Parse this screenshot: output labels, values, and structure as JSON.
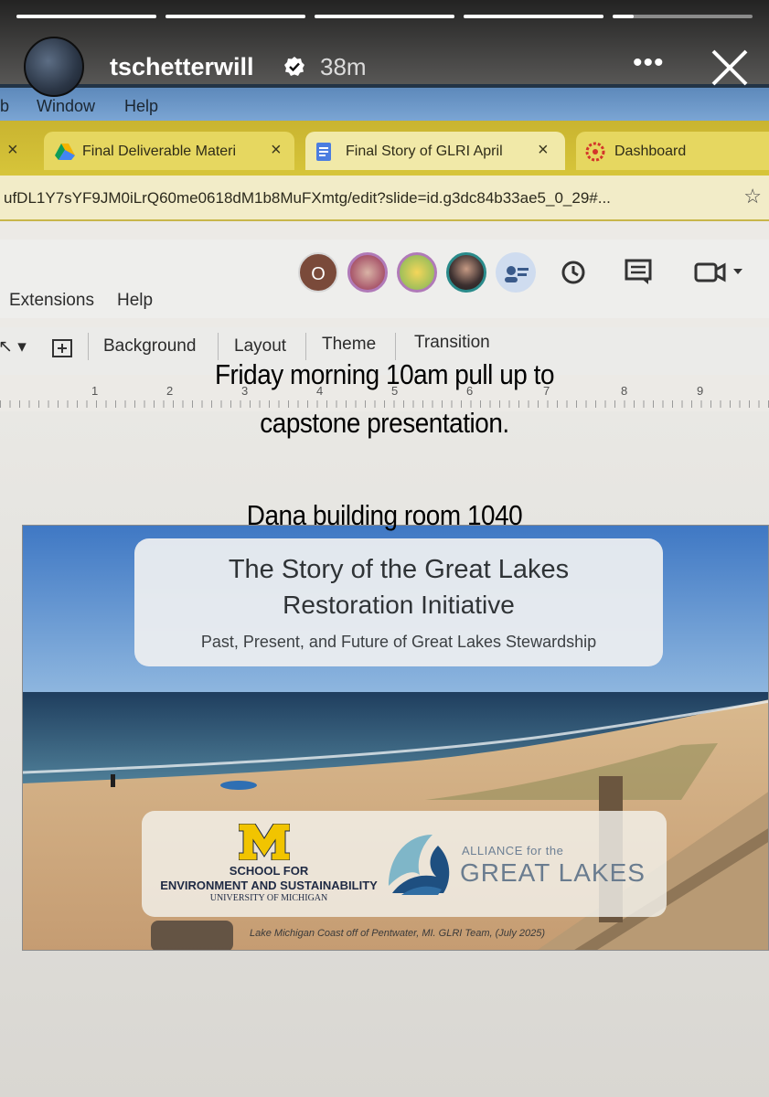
{
  "story": {
    "username": "tschetterwill",
    "time_ago": "38m",
    "progress_segments": [
      1,
      1,
      1,
      1,
      0.15
    ],
    "text_lines": [
      "Friday morning 10am pull up to",
      "capstone presentation.",
      "Dana building room 1040"
    ]
  },
  "browser": {
    "menu": [
      "b",
      "Window",
      "Help"
    ],
    "tabs": [
      {
        "label": "Final Deliverable Materi",
        "icon": "drive-icon"
      },
      {
        "label": "Final Story of GLRI April",
        "icon": "slides-icon"
      },
      {
        "label": "Dashboard",
        "icon": "canvas-icon"
      }
    ],
    "url": "ufDL1Y7sYF9JM0iLrQ60me0618dM1b8MuFXmtg/edit?slide=id.g3dc84b33ae5_0_29#...",
    "doc_menu": [
      "Extensions",
      "Help"
    ],
    "avatar_initial": "O",
    "toolbar": [
      "Background",
      "Layout",
      "Theme",
      "Transition"
    ],
    "ruler_numbers": [
      "1",
      "2",
      "3",
      "4",
      "5",
      "6",
      "7",
      "8",
      "9"
    ]
  },
  "slide": {
    "title_line1": "The Story of the Great Lakes",
    "title_line2": "Restoration Initiative",
    "subtitle": "Past, Present, and Future of Great Lakes Stewardship",
    "um_line1": "SCHOOL FOR",
    "um_line2": "ENVIRONMENT AND SUSTAINABILITY",
    "um_line3": "UNIVERSITY OF MICHIGAN",
    "agl_small": "ALLIANCE for the",
    "agl_big": "GREAT LAKES",
    "caption": "Lake Michigan Coast off of Pentwater, MI. GLRI Team, (July 2025)"
  },
  "colors": {
    "brand_maize": "#f1c400",
    "um_blue": "#1f2a44",
    "tab_yellow": "#d7c53a"
  }
}
